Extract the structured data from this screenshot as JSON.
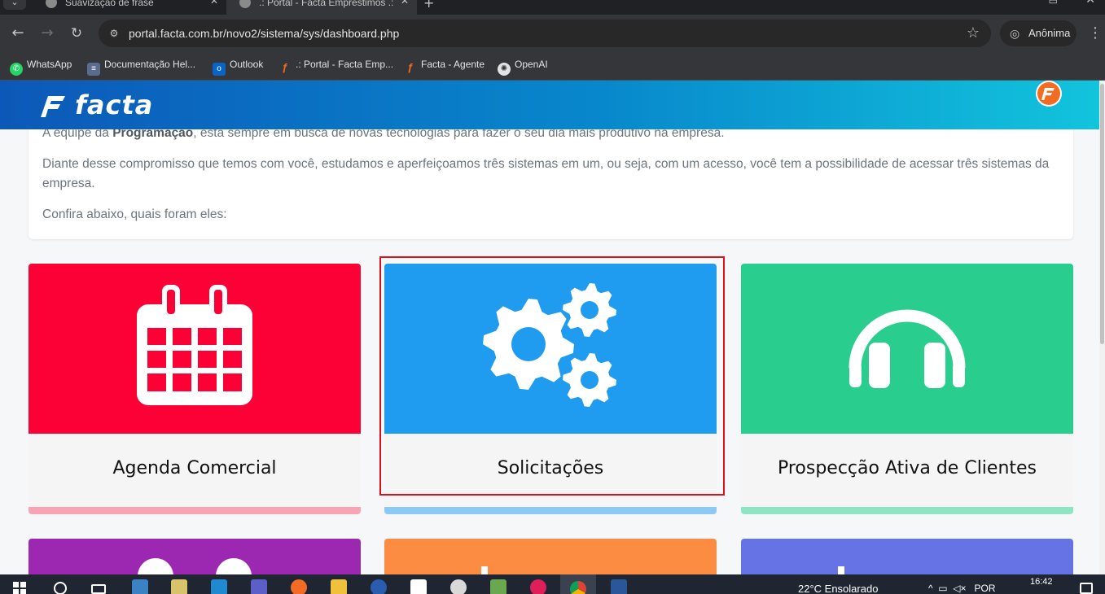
{
  "browser": {
    "tabs": [
      {
        "title": "Suavização de frase",
        "active": false
      },
      {
        "title": ".: Portal - Facta Empréstimos .:",
        "active": true
      }
    ],
    "url": "portal.facta.com.br/novo2/sistema/sys/dashboard.php",
    "profile_label": "Anônima",
    "bookmarks": [
      {
        "label": "WhatsApp",
        "icon": "whatsapp-icon"
      },
      {
        "label": "Documentação Hel...",
        "icon": "doc-icon"
      },
      {
        "label": "Outlook",
        "icon": "outlook-icon"
      },
      {
        "label": ".: Portal - Facta Emp...",
        "icon": "facta-icon"
      },
      {
        "label": "Facta - Agente",
        "icon": "facta-icon"
      },
      {
        "label": "OpenAI",
        "icon": "openai-icon"
      }
    ]
  },
  "header": {
    "logo_text": "facta"
  },
  "intro": {
    "p1_before": "A equipe da ",
    "p1_strong": "Programação",
    "p1_after": ", está sempre em busca de novas tecnologias para fazer o seu dia mais produtivo na empresa.",
    "p2": "Diante desse compromisso que temos com você, estudamos e aperfeiçoamos três sistemas em um, ou seja, com um acesso, você tem a possibilidade de acessar três sistemas da empresa.",
    "p3": "Confira abaixo, quais foram eles:"
  },
  "tiles": [
    {
      "label": "Agenda Comercial",
      "icon": "calendar-icon",
      "color": "#fc0135"
    },
    {
      "label": "Solicitações",
      "icon": "gears-icon",
      "color": "#1f9cf0"
    },
    {
      "label": "Prospecção Ativa de Clientes",
      "icon": "headphones-icon",
      "color": "#29ce8f"
    }
  ],
  "taskbar": {
    "weather": "22°C  Ensolarado",
    "lang": "POR",
    "time": "16:42"
  }
}
